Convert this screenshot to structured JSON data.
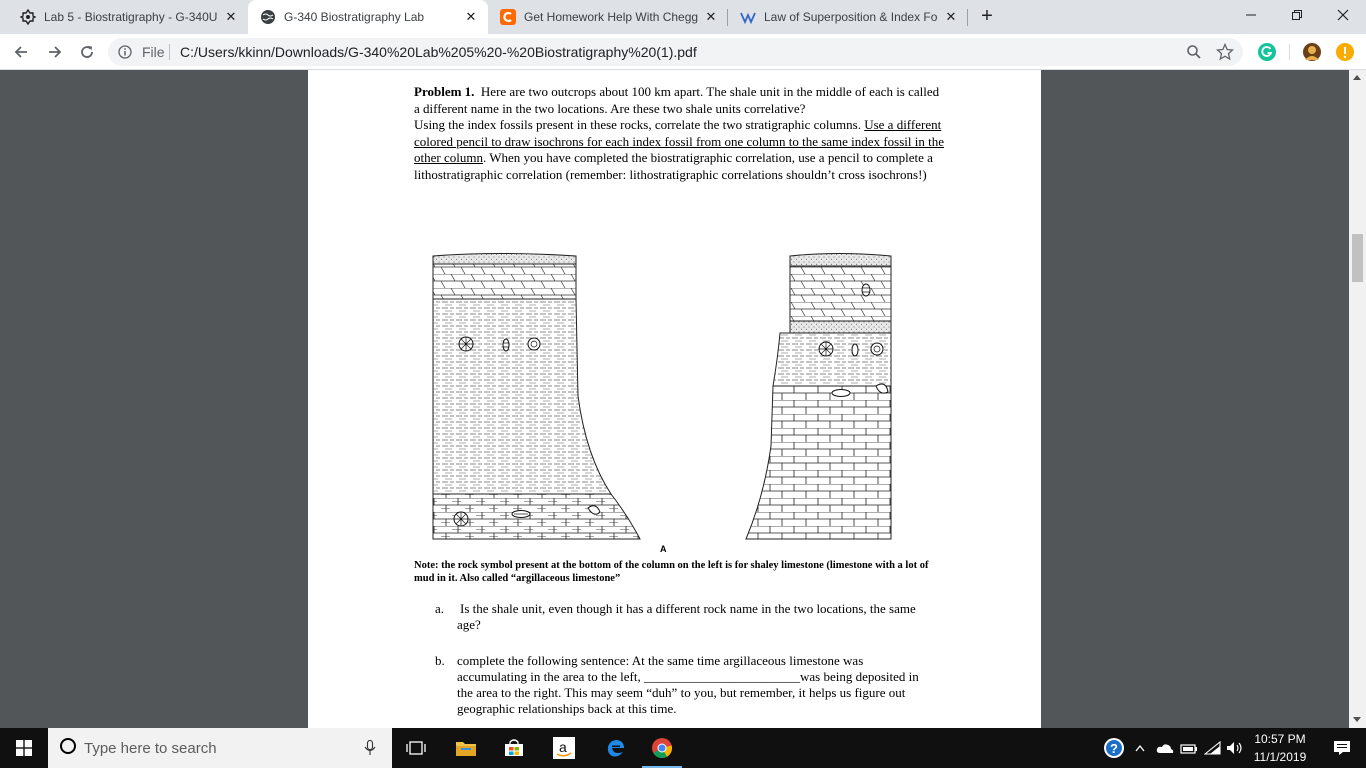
{
  "tabs": [
    {
      "title": "Lab 5 - Biostratigraphy - G-340U",
      "icon": "puzzle-icon",
      "active": false
    },
    {
      "title": "G-340 Biostratigraphy Lab",
      "icon": "globe-icon",
      "active": true
    },
    {
      "title": "Get Homework Help With Chegg",
      "icon": "chegg-icon",
      "active": false
    },
    {
      "title": "Law of Superposition & Index Fo",
      "icon": "wikipedia-icon",
      "active": false
    }
  ],
  "toolbar": {
    "file_label": "File",
    "url": "C:/Users/kkinn/Downloads/G-340%20Lab%205%20-%20Biostratigraphy%20(1).pdf"
  },
  "document": {
    "problem_title": "Problem 1.",
    "intro": "Here are two outcrops about 100 km apart.  The shale unit in the middle of each is called a different name in the two locations.  Are these two shale units correlative?",
    "instruction_start": "Using the index fossils present in these rocks, correlate the two stratigraphic columns.",
    "instruction_underlined": "Use a different colored pencil to draw isochrons for each index fossil from one column to the same index fossil in the other column",
    "instruction_end": ".  When you have completed the biostratigraphic correlation, use a pencil to complete a lithostratigraphic correlation (remember: lithostratigraphic correlations shouldn’t cross isochrons!)",
    "figure_label": "A",
    "note": "Note: the rock symbol present at the bottom of the column on the left is for shaley limestone (limestone with a lot of mud in it.  Also called “argillaceous limestone”",
    "question_a_label": "a.",
    "question_a": "Is the shale unit, even though it has a different rock name in the two locations, the same age?",
    "question_b_label": "b.",
    "question_b": "complete the following sentence:  At the same time argillaceous limestone was accumulating in the area to the left, ________________________was being deposited in the area to the right.  This may seem “duh” to you, but remember, it helps us figure out geographic relationships back at this time."
  },
  "taskbar": {
    "search_placeholder": "Type here to search",
    "time": "10:57 PM",
    "date": "11/1/2019"
  },
  "colors": {
    "tabbar_bg": "#dee1e6",
    "viewer_bg": "#525659",
    "chegg_orange": "#ff6a00",
    "wiki_blue": "#3366cc",
    "grammarly_green": "#15c39a",
    "taskbar_bg": "#101010"
  }
}
